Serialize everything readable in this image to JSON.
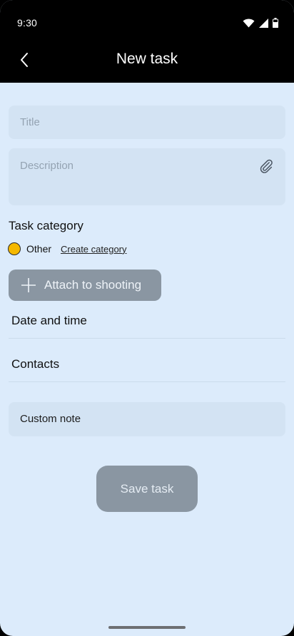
{
  "status_bar": {
    "time": "9:30",
    "icons": [
      "wifi-icon",
      "cellular-signal-icon",
      "battery-icon"
    ]
  },
  "header": {
    "back_icon": "chevron-left-icon",
    "title": "New task"
  },
  "form": {
    "title_placeholder": "Title",
    "description_placeholder": "Description",
    "attachment_icon": "paperclip-icon",
    "category_section_label": "Task category",
    "category": {
      "name": "Other",
      "color": "#F5B800"
    },
    "create_category_link": "Create category",
    "attach_shooting_label": "Attach to shooting",
    "date_time_label": "Date and time",
    "contacts_label": "Contacts",
    "custom_note_label": "Custom note",
    "save_label": "Save task"
  },
  "colors": {
    "background": "#DCEBFB",
    "field": "#D3E3F3",
    "disabled_button": "#8A96A2",
    "header": "#000000"
  }
}
